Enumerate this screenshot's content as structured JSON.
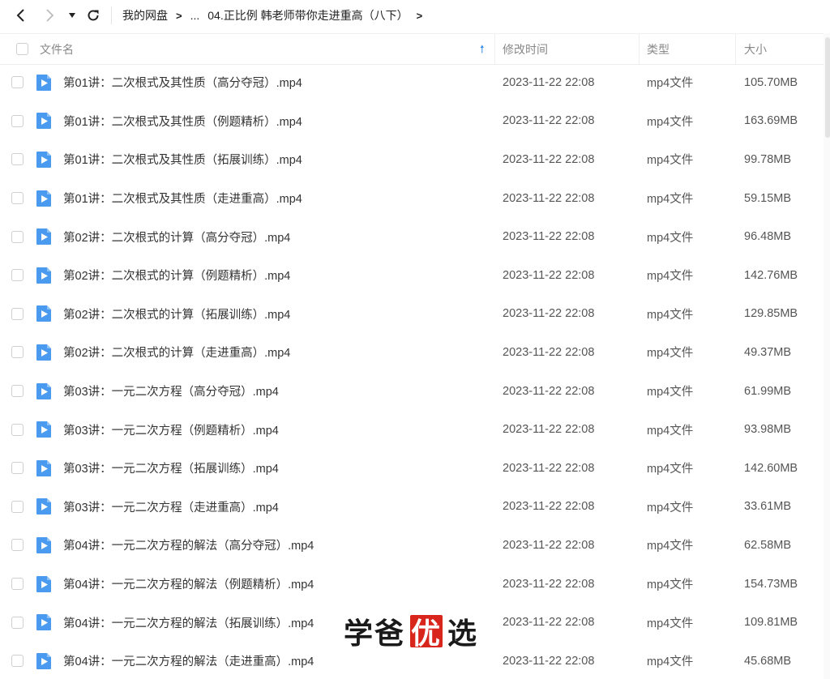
{
  "breadcrumb": {
    "root": "我的网盘",
    "ellipsis": "...",
    "current": "04.正比例 韩老师带你走进重高（八下）"
  },
  "header": {
    "name": "文件名",
    "modified": "修改时间",
    "type": "类型",
    "size": "大小"
  },
  "files": [
    {
      "name": "第01讲：二次根式及其性质（高分夺冠）.mp4",
      "modified": "2023-11-22 22:08",
      "type": "mp4文件",
      "size": "105.70MB"
    },
    {
      "name": "第01讲：二次根式及其性质（例题精析）.mp4",
      "modified": "2023-11-22 22:08",
      "type": "mp4文件",
      "size": "163.69MB"
    },
    {
      "name": "第01讲：二次根式及其性质（拓展训练）.mp4",
      "modified": "2023-11-22 22:08",
      "type": "mp4文件",
      "size": "99.78MB"
    },
    {
      "name": "第01讲：二次根式及其性质（走进重高）.mp4",
      "modified": "2023-11-22 22:08",
      "type": "mp4文件",
      "size": "59.15MB"
    },
    {
      "name": "第02讲：二次根式的计算（高分夺冠）.mp4",
      "modified": "2023-11-22 22:08",
      "type": "mp4文件",
      "size": "96.48MB"
    },
    {
      "name": "第02讲：二次根式的计算（例题精析）.mp4",
      "modified": "2023-11-22 22:08",
      "type": "mp4文件",
      "size": "142.76MB"
    },
    {
      "name": "第02讲：二次根式的计算（拓展训练）.mp4",
      "modified": "2023-11-22 22:08",
      "type": "mp4文件",
      "size": "129.85MB"
    },
    {
      "name": "第02讲：二次根式的计算（走进重高）.mp4",
      "modified": "2023-11-22 22:08",
      "type": "mp4文件",
      "size": "49.37MB"
    },
    {
      "name": "第03讲：一元二次方程（高分夺冠）.mp4",
      "modified": "2023-11-22 22:08",
      "type": "mp4文件",
      "size": "61.99MB"
    },
    {
      "name": "第03讲：一元二次方程（例题精析）.mp4",
      "modified": "2023-11-22 22:08",
      "type": "mp4文件",
      "size": "93.98MB"
    },
    {
      "name": "第03讲：一元二次方程（拓展训练）.mp4",
      "modified": "2023-11-22 22:08",
      "type": "mp4文件",
      "size": "142.60MB"
    },
    {
      "name": "第03讲：一元二次方程（走进重高）.mp4",
      "modified": "2023-11-22 22:08",
      "type": "mp4文件",
      "size": "33.61MB"
    },
    {
      "name": "第04讲：一元二次方程的解法（高分夺冠）.mp4",
      "modified": "2023-11-22 22:08",
      "type": "mp4文件",
      "size": "62.58MB"
    },
    {
      "name": "第04讲：一元二次方程的解法（例题精析）.mp4",
      "modified": "2023-11-22 22:08",
      "type": "mp4文件",
      "size": "154.73MB"
    },
    {
      "name": "第04讲：一元二次方程的解法（拓展训练）.mp4",
      "modified": "2023-11-22 22:08",
      "type": "mp4文件",
      "size": "109.81MB"
    },
    {
      "name": "第04讲：一元二次方程的解法（走进重高）.mp4",
      "modified": "2023-11-22 22:08",
      "type": "mp4文件",
      "size": "45.68MB"
    }
  ],
  "watermark": {
    "part1": "学爸",
    "part2": "优",
    "part3": "选"
  },
  "colors": {
    "accent": "#3b8fe8",
    "file_icon": "#4a9af0",
    "watermark_box": "#d8261c"
  },
  "icons": {
    "back": "chevron-left-icon",
    "forward": "chevron-right-icon",
    "history": "triangle-down-icon",
    "refresh": "refresh-icon",
    "file": "video-file-icon",
    "sort": "arrow-up-icon"
  }
}
